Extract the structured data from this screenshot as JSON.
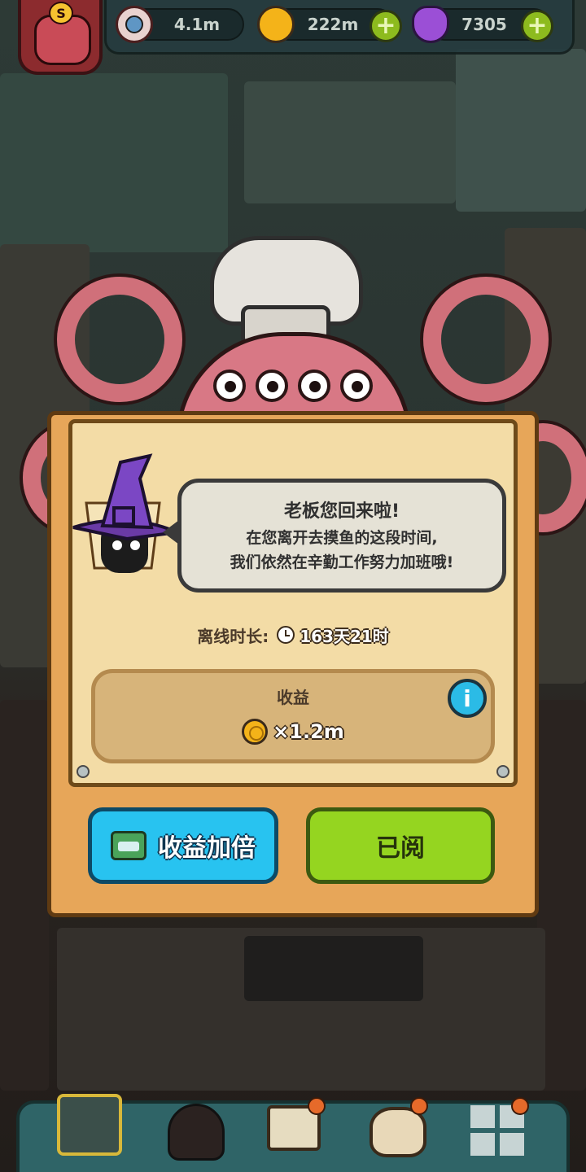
{
  "top_bar": {
    "eyeballs": "4.1m",
    "coins": "222m",
    "potions": "7305",
    "avatar_badge": "S"
  },
  "dialog": {
    "speech_title": "老板您回来啦!",
    "speech_line2": "在您离开去摸鱼的这段时间,",
    "speech_line3": "我们依然在辛勤工作努力加班哦!",
    "offline_label": "离线时长:",
    "offline_value": "163天21时",
    "income_title": "收益",
    "income_amount": "×1.2m",
    "info_label": "i",
    "double_button": "收益加倍",
    "read_button": "已阅"
  },
  "bottom_nav": {
    "items": [
      "shop-icon",
      "monster-icon",
      "book-icon",
      "money-bag-icon",
      "grid-icon"
    ]
  },
  "colors": {
    "board": "#e7a659",
    "paper": "#f3dca6",
    "blue_button": "#28c3f0",
    "green_button": "#95d520",
    "coin": "#f4b319"
  }
}
